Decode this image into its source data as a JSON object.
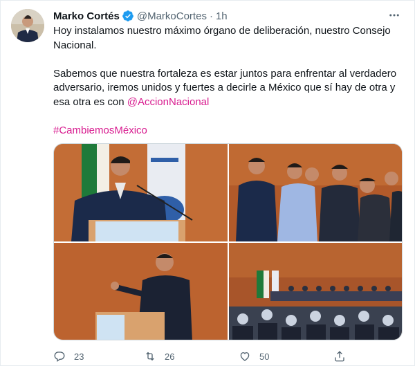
{
  "tweet": {
    "author_name": "Marko Cortés",
    "handle": "@MarkoCortes",
    "separator": "·",
    "time": "1h",
    "text_p1": "Hoy instalamos nuestro máximo órgano de deliberación, nuestro Consejo Nacional.",
    "text_p2": "Sabemos que nuestra fortaleza es estar juntos para enfrentar al verdadero adversario, iremos unidos y fuertes a decirle a México que sí hay de otra y esa otra es con",
    "mention": "@AccionNacional",
    "hashtag": "#CambiemosMéxico"
  },
  "metrics": {
    "replies": "23",
    "retweets": "26",
    "likes": "50"
  },
  "icons": {
    "verified": "verified-badge-icon",
    "more": "more-options-icon",
    "reply": "reply-icon",
    "retweet": "retweet-icon",
    "like": "heart-icon",
    "share": "share-icon"
  },
  "colors": {
    "link": "#d81b8f",
    "muted": "#536471",
    "verified": "#1d9bf0"
  }
}
